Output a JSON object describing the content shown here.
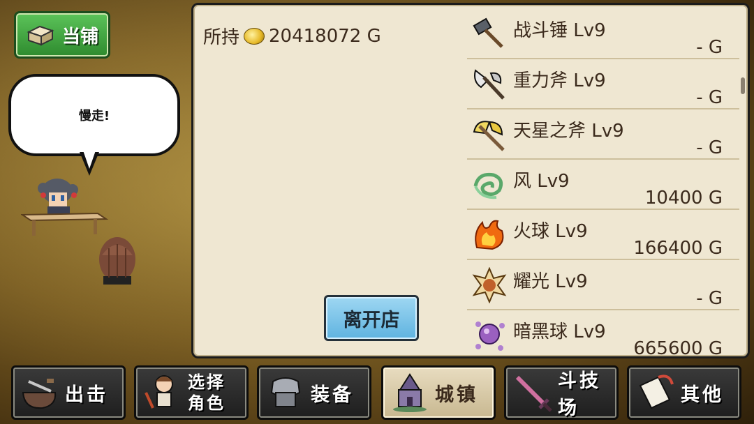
{
  "shop_badge": {
    "label": "当铺",
    "icon": "box-icon"
  },
  "speech": {
    "text": "慢走!"
  },
  "funds": {
    "label": "所持",
    "amount": "20418072 G"
  },
  "leave_button": {
    "label": "离开店"
  },
  "items": [
    {
      "name": "战斗锤 Lv9",
      "price": "- G",
      "icon": "hammer-icon"
    },
    {
      "name": "重力斧 Lv9",
      "price": "- G",
      "icon": "axe-icon"
    },
    {
      "name": "天星之斧 Lv9",
      "price": "- G",
      "icon": "star-axe-icon"
    },
    {
      "name": "风 Lv9",
      "price": "10400 G",
      "icon": "wind-icon"
    },
    {
      "name": "火球 Lv9",
      "price": "166400 G",
      "icon": "fireball-icon"
    },
    {
      "name": "耀光 Lv9",
      "price": "- G",
      "icon": "flash-icon"
    },
    {
      "name": "暗黑球 Lv9",
      "price": "665600 G",
      "icon": "dark-orb-icon"
    }
  ],
  "nav": [
    {
      "label": "出击",
      "icon": "sortie-icon",
      "active": false
    },
    {
      "label_line1": "选择",
      "label_line2": "角色",
      "icon": "character-icon",
      "active": false
    },
    {
      "label": "装备",
      "icon": "armor-icon",
      "active": false
    },
    {
      "label": "城镇",
      "icon": "town-icon",
      "active": true
    },
    {
      "label": "斗技场",
      "icon": "sword-icon",
      "active": false
    },
    {
      "label": "其他",
      "icon": "scroll-icon",
      "active": false
    }
  ]
}
